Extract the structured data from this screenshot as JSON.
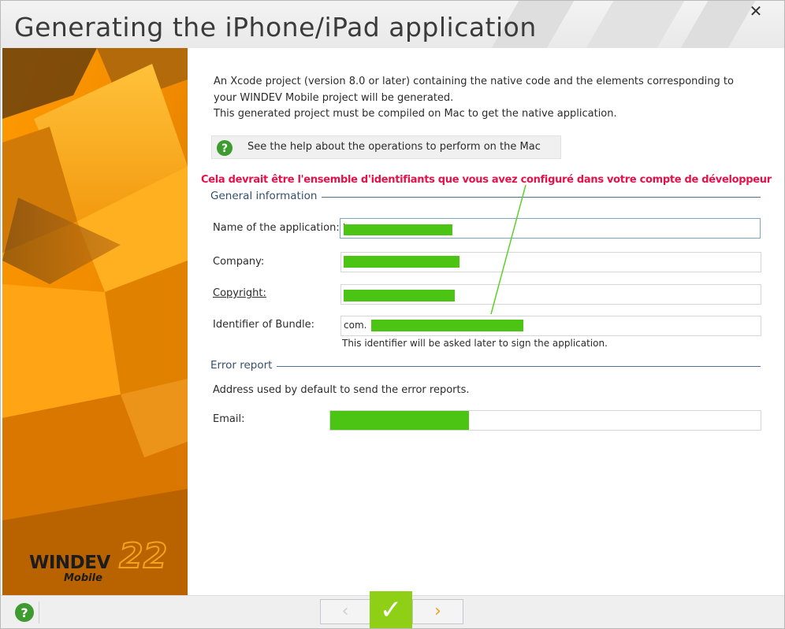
{
  "window": {
    "title": "Generating the iPhone/iPad application",
    "close_glyph": "✕"
  },
  "brand": {
    "main": "WINDEV",
    "sub": "Mobile",
    "version": "22"
  },
  "intro": {
    "line1": "An Xcode project (version 8.0 or later) containing the native code and the elements corresponding to",
    "line2": "your WINDEV Mobile project will be generated.",
    "line3": "This generated project must be compiled on Mac to get the native application."
  },
  "help_link": {
    "label": "See the help about the operations to perform on the Mac",
    "icon": "help-circle-icon"
  },
  "annotation": {
    "text": "Cela devrait être l'ensemble d'identifiants que vous avez configuré dans votre compte de développeur",
    "color": "#e4124a",
    "arrow_color": "#5bd12a"
  },
  "general": {
    "title": "General information",
    "app_name_label": "Name of the application:",
    "company_label": "Company:",
    "copyright_label": "Copyright:",
    "bundle_label": "Identifier of Bundle:",
    "bundle_prefix": "com.",
    "bundle_hint": "This identifier will be asked later to sign the application."
  },
  "error_report": {
    "title": "Error report",
    "note": "Address used by default to send the error reports.",
    "email_label": "Email:"
  },
  "footer": {
    "prev_glyph": "‹",
    "ok_glyph": "✓",
    "next_glyph": "›",
    "ok_color": "#8fd017",
    "next_color": "#f0a020"
  },
  "colors": {
    "accent_section": "#34506e",
    "redaction": "#4cc414",
    "sidebar_orange": "#f08c00"
  }
}
